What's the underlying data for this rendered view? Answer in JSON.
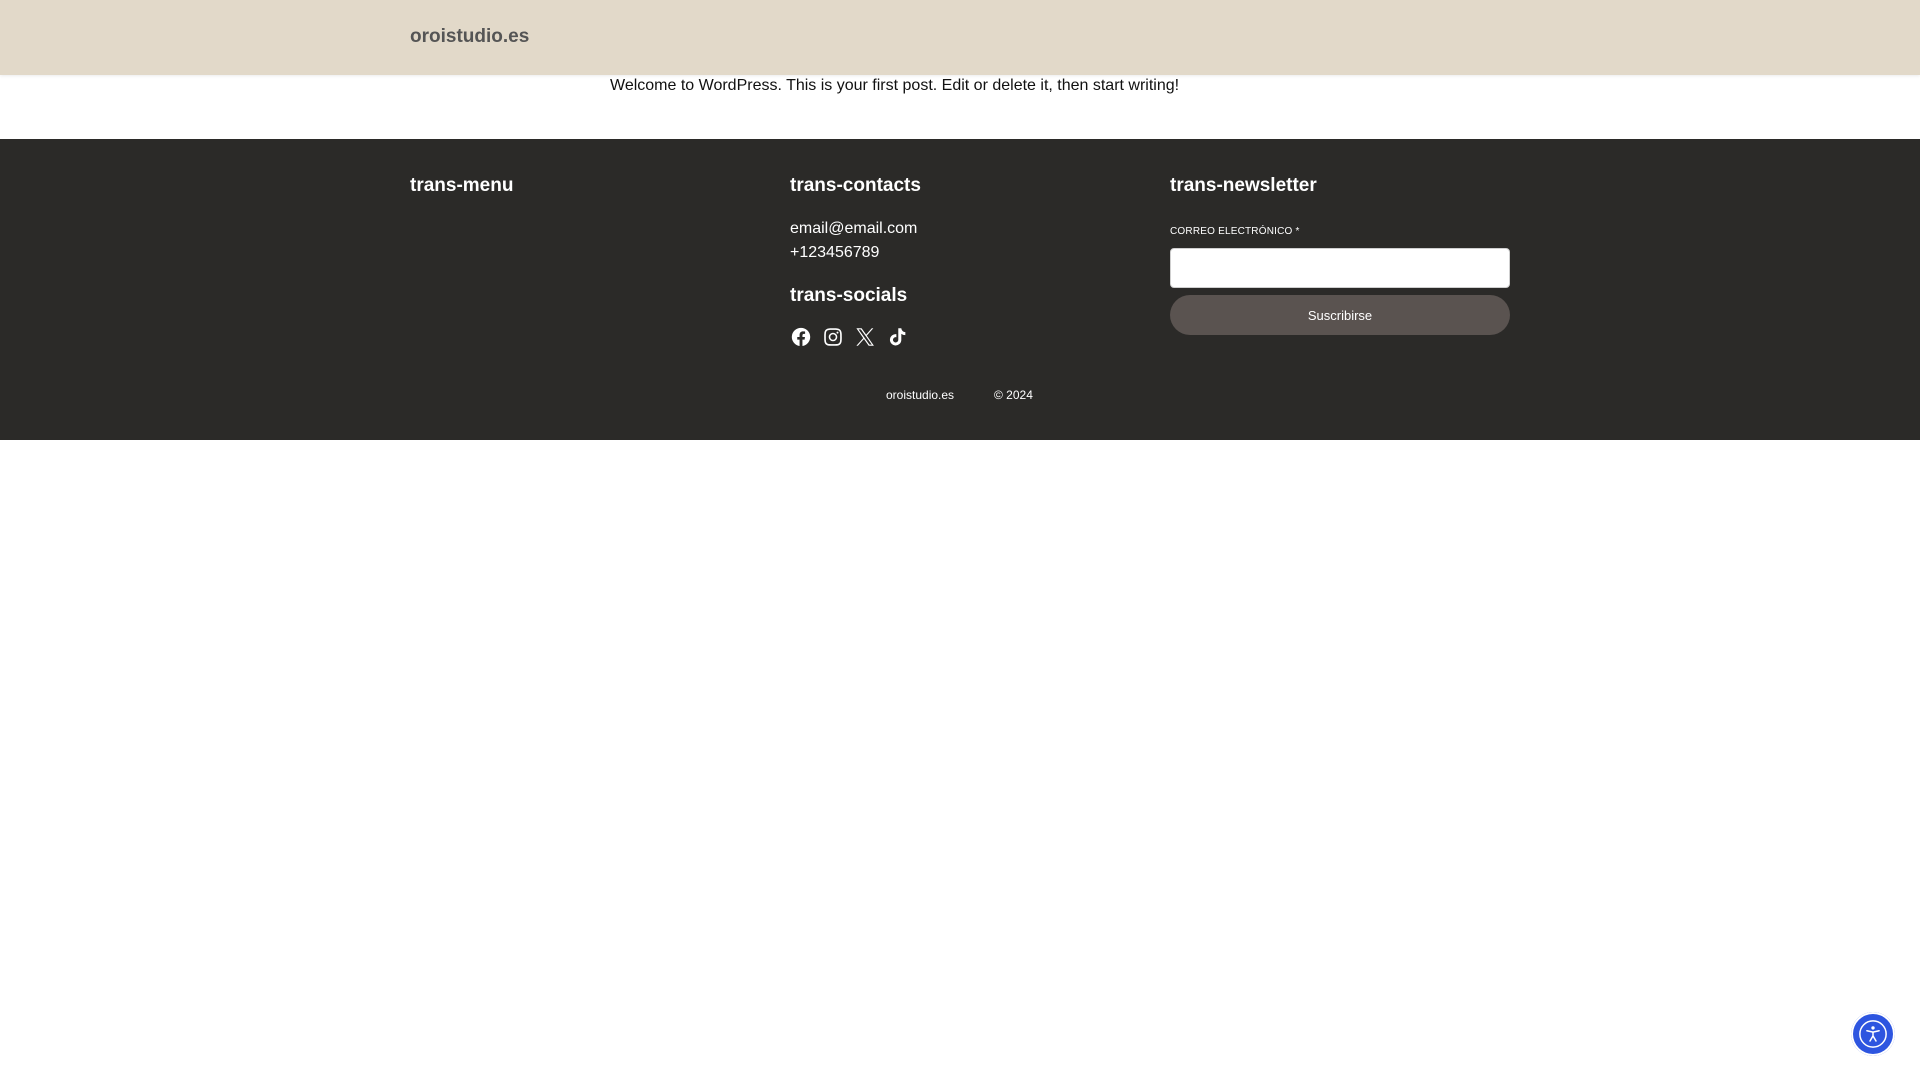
{
  "header": {
    "site_title": "oroistudio.es"
  },
  "post": {
    "text": "Welcome to WordPress. This is your first post. Edit or delete it, then start writing!"
  },
  "footer": {
    "menu_heading": "trans-menu",
    "contacts_heading": "trans-contacts",
    "email": "email@email.com",
    "phone": "+123456789",
    "socials_heading": "trans-socials",
    "socials": [
      {
        "name": "facebook-icon"
      },
      {
        "name": "instagram-icon"
      },
      {
        "name": "x-icon"
      },
      {
        "name": "tiktok-icon"
      }
    ],
    "newsletter_heading": "trans-newsletter",
    "newsletter_label": "CORREO ELECTRÓNICO *",
    "newsletter_input_value": "",
    "newsletter_button": "Suscribirse",
    "bottom_site": "oroistudio.es",
    "copyright": "© 2024"
  },
  "accessibility": {
    "icon": "accessibility-icon",
    "color": "#2d55e0"
  },
  "colors": {
    "header_bg": "#e2d9c9",
    "footer_bg": "#2b2a28",
    "button_bg": "#5a5350"
  }
}
